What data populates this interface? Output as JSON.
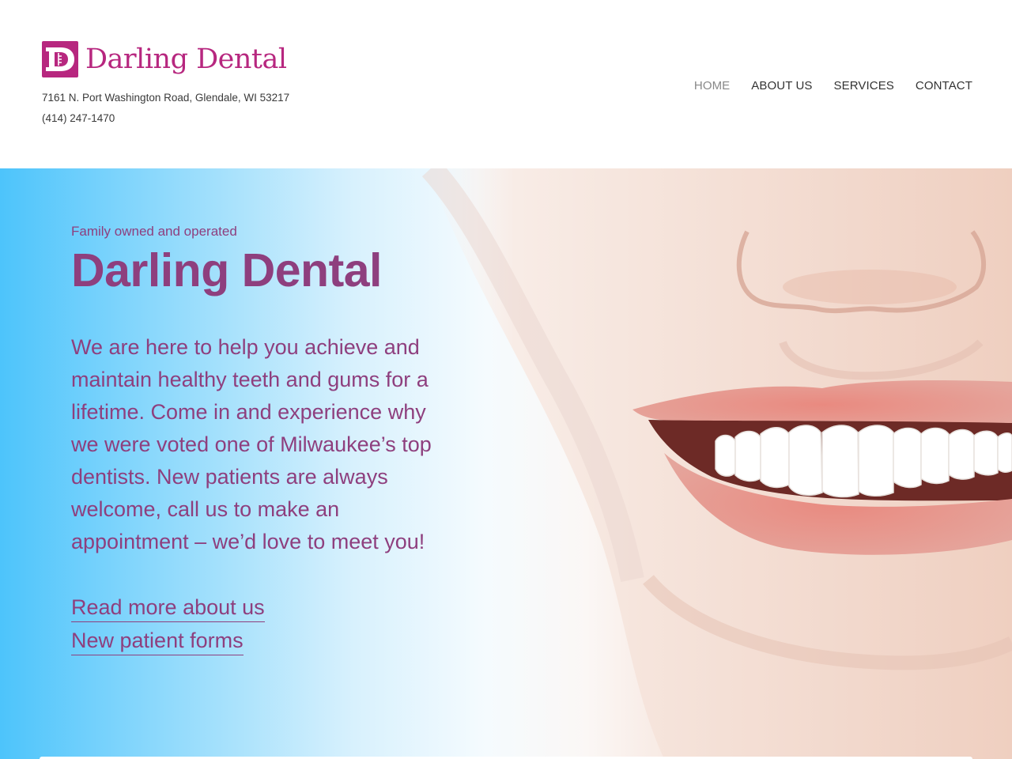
{
  "brand": {
    "logo_letter": "D",
    "name": "Darling Dental",
    "color": "#b7277f"
  },
  "contact": {
    "address": "7161 N. Port Washington Road, Glendale, WI 53217",
    "phone": "(414) 247-1470"
  },
  "nav": {
    "items": [
      {
        "label": "HOME",
        "active": true
      },
      {
        "label": "ABOUT US",
        "active": false
      },
      {
        "label": "SERVICES",
        "active": false
      },
      {
        "label": "CONTACT",
        "active": false
      }
    ]
  },
  "hero": {
    "tagline": "Family owned and operated",
    "title": "Darling Dental",
    "body": "We are here to help you achieve and maintain healthy teeth and gums for a lifetime. Come in and experience why we were voted one of Milwaukee’s top dentists. New patients are always welcome, call us to make an appointment – we’d love to meet you!",
    "links": [
      {
        "label": "Read more about us"
      },
      {
        "label": "New patient forms"
      }
    ],
    "text_color": "#8e3f7e",
    "background_accent": "#4dc4fb"
  }
}
